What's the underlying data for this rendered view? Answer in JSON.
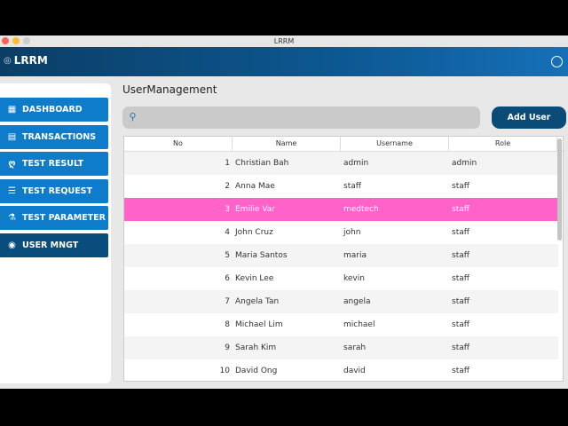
{
  "window": {
    "title": "LRRM"
  },
  "header": {
    "app_name": "LRRM"
  },
  "sidebar": {
    "items": [
      {
        "label": "DASHBOARD",
        "icon": "dashboard-icon"
      },
      {
        "label": "TRANSACTIONS",
        "icon": "document-icon"
      },
      {
        "label": "TEST RESULT",
        "icon": "stethoscope-icon"
      },
      {
        "label": "TEST REQUEST",
        "icon": "checklist-icon"
      },
      {
        "label": "TEST PARAMETER",
        "icon": "flask-icon"
      },
      {
        "label": "USER MNGT",
        "icon": "user-icon"
      }
    ]
  },
  "main": {
    "title": "UserManagement",
    "search_placeholder": "",
    "add_label": "Add User",
    "columns": [
      "No",
      "Name",
      "Username",
      "Role"
    ],
    "rows": [
      [
        "1",
        "Christian Bah",
        "admin",
        "admin"
      ],
      [
        "2",
        "Anna Mae",
        "staff",
        "staff"
      ],
      [
        "3",
        "Emilie Var",
        "medtech",
        "staff"
      ],
      [
        "4",
        "John Cruz",
        "john",
        "staff"
      ],
      [
        "5",
        "Maria Santos",
        "maria",
        "staff"
      ],
      [
        "6",
        "Kevin Lee",
        "kevin",
        "staff"
      ],
      [
        "7",
        "Angela Tan",
        "angela",
        "staff"
      ],
      [
        "8",
        "Michael Lim",
        "michael",
        "staff"
      ],
      [
        "9",
        "Sarah Kim",
        "sarah",
        "staff"
      ],
      [
        "10",
        "David Ong",
        "david",
        "staff"
      ]
    ],
    "selected_row": 2
  },
  "colors": {
    "accent": "#0f7ccb",
    "active": "#0a4d7c",
    "selected": "#ff62c8"
  }
}
